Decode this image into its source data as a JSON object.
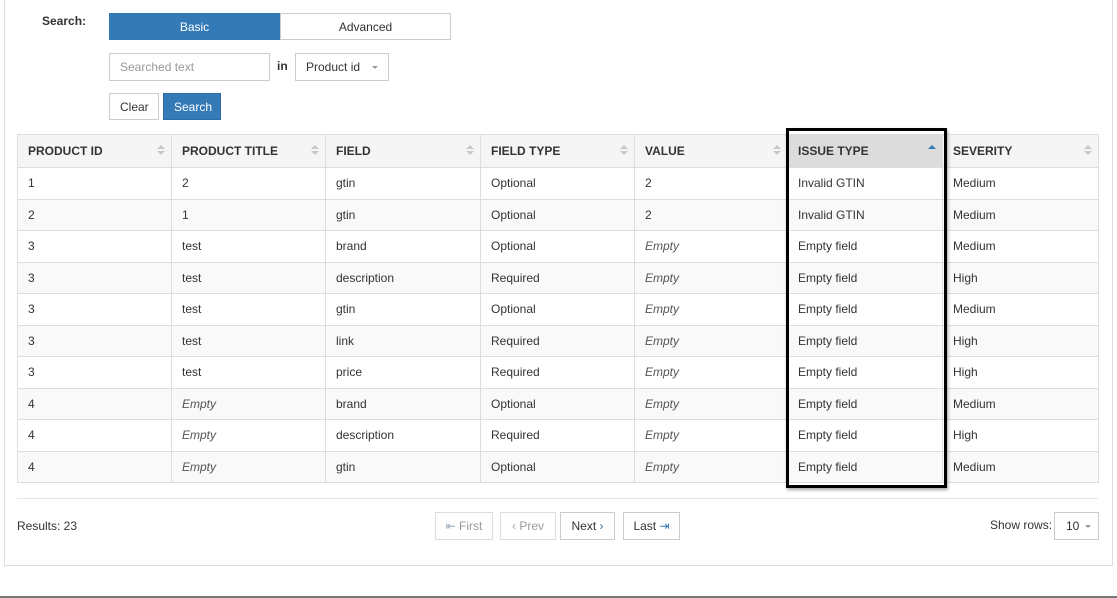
{
  "search": {
    "label": "Search:",
    "modes": [
      {
        "label": "Basic",
        "active": true
      },
      {
        "label": "Advanced",
        "active": false
      }
    ],
    "input_placeholder": "Searched text",
    "input_value": "",
    "in_label": "in",
    "field_selected": "Product id",
    "clear_label": "Clear",
    "search_label": "Search"
  },
  "table": {
    "columns": [
      {
        "label": "PRODUCT ID",
        "sort": "none"
      },
      {
        "label": "PRODUCT TITLE",
        "sort": "none"
      },
      {
        "label": "FIELD",
        "sort": "none"
      },
      {
        "label": "FIELD TYPE",
        "sort": "none"
      },
      {
        "label": "VALUE",
        "sort": "none"
      },
      {
        "label": "ISSUE TYPE",
        "sort": "asc"
      },
      {
        "label": "SEVERITY",
        "sort": "none"
      }
    ],
    "highlighted_column": "ISSUE TYPE",
    "rows": [
      [
        "1",
        "2",
        "gtin",
        "Optional",
        "2",
        "Invalid GTIN",
        "Medium"
      ],
      [
        "2",
        "1",
        "gtin",
        "Optional",
        "2",
        "Invalid GTIN",
        "Medium"
      ],
      [
        "3",
        "test",
        "brand",
        "Optional",
        "Empty",
        "Empty field",
        "Medium"
      ],
      [
        "3",
        "test",
        "description",
        "Required",
        "Empty",
        "Empty field",
        "High"
      ],
      [
        "3",
        "test",
        "gtin",
        "Optional",
        "Empty",
        "Empty field",
        "Medium"
      ],
      [
        "3",
        "test",
        "link",
        "Required",
        "Empty",
        "Empty field",
        "High"
      ],
      [
        "3",
        "test",
        "price",
        "Required",
        "Empty",
        "Empty field",
        "High"
      ],
      [
        "4",
        "Empty",
        "brand",
        "Optional",
        "Empty",
        "Empty field",
        "Medium"
      ],
      [
        "4",
        "Empty",
        "description",
        "Required",
        "Empty",
        "Empty field",
        "High"
      ],
      [
        "4",
        "Empty",
        "gtin",
        "Optional",
        "Empty",
        "Empty field",
        "Medium"
      ]
    ],
    "empty_placeholder": "Empty"
  },
  "footer": {
    "results": "Results: 23",
    "pagination": {
      "first": {
        "label": "First",
        "icon": "⇤",
        "disabled": true
      },
      "prev": {
        "label": "Prev",
        "icon": "‹",
        "disabled": true
      },
      "next": {
        "label": "Next",
        "icon": "›",
        "disabled": false
      },
      "last": {
        "label": "Last",
        "icon": "⇥",
        "disabled": false
      }
    },
    "show_rows_label": "Show rows:",
    "show_rows_value": "10"
  },
  "colors": {
    "accent": "#337ab7",
    "sorted_header_bg": "#dcdcdc",
    "highlight_border": "#000000"
  }
}
